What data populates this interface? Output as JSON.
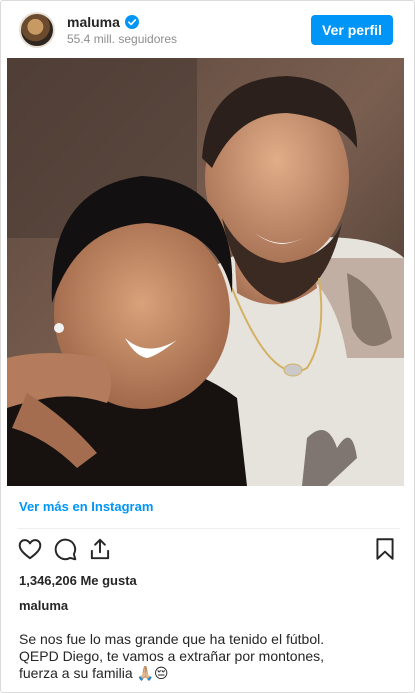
{
  "post": {
    "username": "maluma",
    "followers": "55.4 mill. seguidores",
    "profile_button": "Ver perfil",
    "more_link": "Ver más en Instagram",
    "likes": "1,346,206 Me gusta",
    "caption_user": "maluma",
    "caption_lines": [
      "Se nos fue lo mas grande que ha tenido el fútbol.",
      "QEPD Diego, te vamos a extrañar por montones,",
      "fuerza a su familia 🙏🏼😔"
    ]
  },
  "icons": {
    "verified": "verified-badge-icon",
    "like": "heart-icon",
    "comment": "comment-icon",
    "share": "share-icon",
    "save": "bookmark-icon"
  },
  "colors": {
    "accent": "#0095f6",
    "text": "#262626",
    "muted": "#8e8e8e"
  }
}
